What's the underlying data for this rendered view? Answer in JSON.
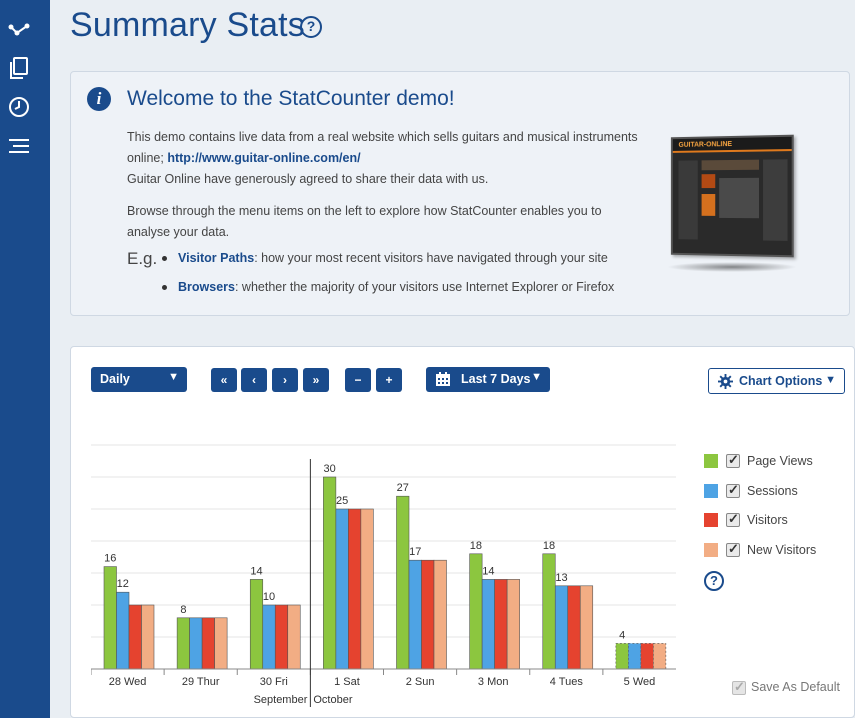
{
  "page": {
    "title": "Summary Stats",
    "help_glyph": "?"
  },
  "sidebar": {
    "items": [
      {
        "icon": "visitor-paths-icon"
      },
      {
        "icon": "pages-icon"
      },
      {
        "icon": "recent-activity-icon"
      },
      {
        "icon": "menu-icon"
      }
    ]
  },
  "welcome": {
    "title": "Welcome to the StatCounter demo!",
    "info_glyph": "i",
    "line1": "This demo contains live data from a real website which sells guitars and musical instruments",
    "line2_prefix": "online; ",
    "link": "http://www.guitar-online.com/en/",
    "line3": "Guitar Online have generously agreed to share their data with us.",
    "line4": "Browse through the menu items on the left to explore how StatCounter enables you to",
    "line5": "analyse your data.",
    "eg": "E.g.",
    "bullets": [
      {
        "label": "Visitor Paths",
        "text": ": how your most recent visitors have navigated through your site"
      },
      {
        "label": "Browsers",
        "text": ": whether the majority of your visitors use Internet Explorer or Firefox"
      }
    ],
    "preview_logo": "GUITAR-ONLINE"
  },
  "toolbar": {
    "period": "Daily",
    "nav": [
      "«",
      "‹",
      "›",
      "»"
    ],
    "zoom": [
      "−",
      "+"
    ],
    "range": "Last 7 Days",
    "chart_options": "Chart Options"
  },
  "legend": {
    "items": [
      {
        "label": "Page Views",
        "color": "#8cc63f"
      },
      {
        "label": "Sessions",
        "color": "#4ea3e4"
      },
      {
        "label": "Visitors",
        "color": "#e5432f"
      },
      {
        "label": "New Visitors",
        "color": "#f2ad84"
      }
    ],
    "help_glyph": "?"
  },
  "save_default": "Save As Default",
  "chart_data": {
    "type": "bar",
    "categories": [
      "28 Wed",
      "29 Thur",
      "30 Fri",
      "1 Sat",
      "2 Sun",
      "3 Mon",
      "4 Tues",
      "5 Wed"
    ],
    "month_labels": [
      {
        "label": "September"
      },
      {
        "label": "October"
      }
    ],
    "series": [
      {
        "name": "Page Views",
        "color": "#8cc63f",
        "values": [
          16,
          8,
          14,
          30,
          27,
          18,
          18,
          4
        ]
      },
      {
        "name": "Sessions",
        "color": "#4ea3e4",
        "values": [
          12,
          8,
          10,
          25,
          17,
          14,
          13,
          4
        ]
      },
      {
        "name": "Visitors",
        "color": "#e5432f",
        "values": [
          10,
          8,
          10,
          25,
          17,
          14,
          13,
          4
        ]
      },
      {
        "name": "New Visitors",
        "color": "#f2ad84",
        "values": [
          10,
          8,
          10,
          25,
          17,
          14,
          13,
          4
        ]
      }
    ],
    "data_labels": [
      [
        {
          "s": 0,
          "v": "16"
        },
        {
          "s": 1,
          "v": "12"
        }
      ],
      [
        {
          "s": 0,
          "v": "8"
        }
      ],
      [
        {
          "s": 0,
          "v": "14"
        },
        {
          "s": 1,
          "v": "10"
        }
      ],
      [
        {
          "s": 0,
          "v": "30"
        },
        {
          "s": 1,
          "v": "25"
        }
      ],
      [
        {
          "s": 0,
          "v": "27"
        },
        {
          "s": 1,
          "v": "17"
        }
      ],
      [
        {
          "s": 0,
          "v": "18"
        },
        {
          "s": 1,
          "v": "14"
        }
      ],
      [
        {
          "s": 0,
          "v": "18"
        },
        {
          "s": 1,
          "v": "13"
        }
      ],
      [
        {
          "s": 0,
          "v": "4"
        }
      ]
    ],
    "ylim": [
      0,
      35
    ],
    "partial_last_category": true,
    "grid": true,
    "legend_position": "right"
  }
}
